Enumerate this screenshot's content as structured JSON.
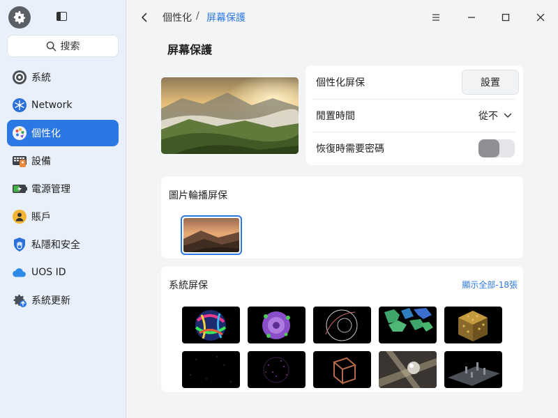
{
  "sidebar": {
    "search_label": "搜索",
    "items": [
      {
        "label": "系統",
        "icon": "system-icon"
      },
      {
        "label": "Network",
        "icon": "network-icon"
      },
      {
        "label": "個性化",
        "icon": "personalization-icon",
        "active": true
      },
      {
        "label": "設備",
        "icon": "devices-icon"
      },
      {
        "label": "電源管理",
        "icon": "power-icon"
      },
      {
        "label": "賬戶",
        "icon": "account-icon"
      },
      {
        "label": "私隱和安全",
        "icon": "privacy-icon"
      },
      {
        "label": "UOS ID",
        "icon": "cloud-icon"
      },
      {
        "label": "系統更新",
        "icon": "update-icon"
      }
    ]
  },
  "header": {
    "breadcrumb_parent": "個性化",
    "breadcrumb_separator": "/",
    "breadcrumb_current": "屏幕保護"
  },
  "page": {
    "title": "屏幕保護",
    "settings": {
      "custom_label": "個性化屏保",
      "setup_button": "設置",
      "idle_label": "閒置時間",
      "idle_value": "從不",
      "password_label": "恢復時需要密碼",
      "password_required": false
    },
    "slideshow": {
      "title": "圖片輪播屏保"
    },
    "system": {
      "title": "系統屏保",
      "show_all": "顯示全部-18張"
    }
  },
  "colors": {
    "accent": "#2b78e4",
    "sidebar_bg": "#e9f0fb",
    "main_bg": "#f3f4f6"
  }
}
